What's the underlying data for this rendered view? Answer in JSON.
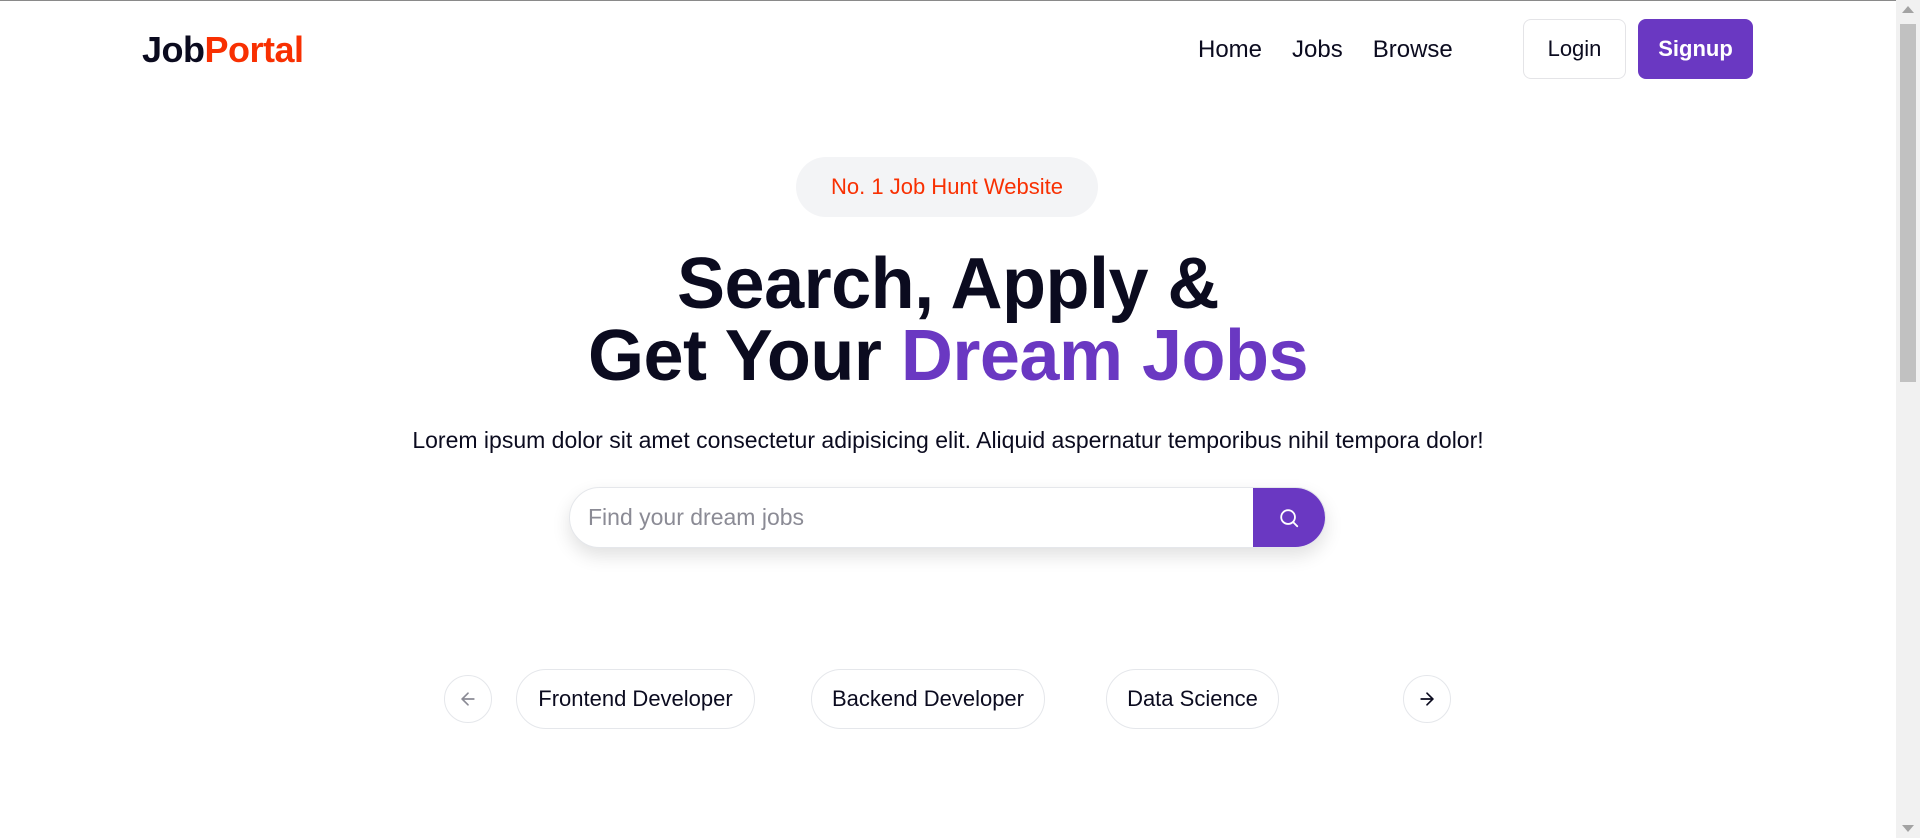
{
  "brand": {
    "part1": "Job",
    "part2": "Portal",
    "color_dark": "#0b0b1f",
    "color_accent": "#f83002"
  },
  "nav": {
    "links": [
      "Home",
      "Jobs",
      "Browse"
    ],
    "login_label": "Login",
    "signup_label": "Signup"
  },
  "hero": {
    "badge": "No. 1 Job Hunt Website",
    "headline_line1": "Search, Apply &",
    "headline_line2_prefix": "Get Your ",
    "headline_line2_accent": "Dream Jobs",
    "subtext": "Lorem ipsum dolor sit amet consectetur adipisicing elit. Aliquid aspernatur temporibus nihil tempora dolor!",
    "search_placeholder": "Find your dream jobs",
    "search_value": ""
  },
  "carousel": {
    "categories": [
      "Frontend Developer",
      "Backend Developer",
      "Data Science"
    ],
    "prev_icon": "arrow-left-icon",
    "next_icon": "arrow-right-icon"
  },
  "colors": {
    "primary": "#6a38c2",
    "badge_text": "#f83002",
    "badge_bg": "#f3f4f6"
  }
}
